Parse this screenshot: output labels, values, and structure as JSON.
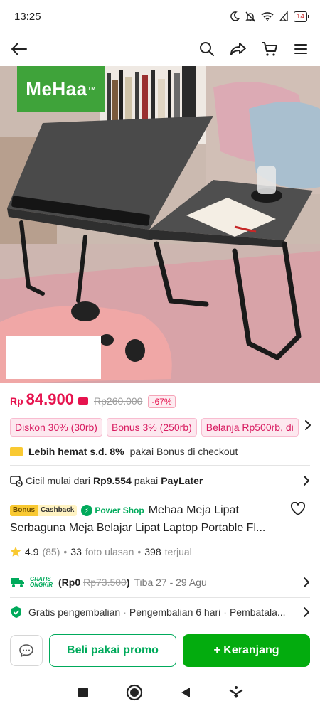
{
  "status_bar": {
    "time": "13:25",
    "battery": "14"
  },
  "product": {
    "brand_logo_text": "MeHaa",
    "price_currency": "Rp",
    "price": "84.900",
    "original_price": "Rp260.000",
    "discount_pct": "-67%",
    "promo_chips": [
      "Diskon 30% (30rb)",
      "Bonus 3% (250rb)",
      "Belanja Rp500rb, di"
    ],
    "hemat_bold": "Lebih hemat s.d. 8%",
    "hemat_rest": "pakai Bonus di checkout",
    "cicil_prefix": "Cicil mulai dari",
    "cicil_amount": "Rp9.554",
    "cicil_mid": "pakai",
    "cicil_method": "PayLater",
    "badge_bonus": "Bonus",
    "badge_cashback": "Cashback",
    "power_shop": "Power Shop",
    "title_line1": "Mehaa Meja Lipat",
    "title_line2": "Serbaguna Meja Belajar Lipat Laptop Portable Fl...",
    "rating": "4.9",
    "rating_count": "(85)",
    "photo_reviews_count": "33",
    "photo_reviews_label": "foto ulasan",
    "sold_count": "398",
    "sold_label": "terjual",
    "gratis_l1": "GRATIS",
    "gratis_l2": "ONGKIR",
    "shipping_prefix": "(Rp0",
    "shipping_old": "Rp73.500",
    "shipping_suffix": ")",
    "shipping_eta": "Tiba 27 - 29 Agu",
    "return_items": [
      "Gratis pengembalian",
      "Pengembalian 6 hari",
      "Pembatala..."
    ]
  },
  "actions": {
    "buy_promo": "Beli pakai promo",
    "add_cart": "+ Keranjang"
  },
  "colors": {
    "accent_red": "#e6134e",
    "accent_green": "#03ac0e",
    "brand_green": "#3fa33a"
  }
}
